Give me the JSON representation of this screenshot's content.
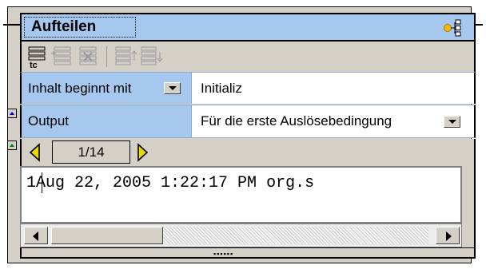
{
  "component": {
    "title": "Aufteilen",
    "title_icon": "connector-handle-icon"
  },
  "toolbar": {
    "buttons": [
      {
        "name": "insert-text-icon",
        "enabled": true
      },
      {
        "name": "insert-after-icon",
        "enabled": false
      },
      {
        "name": "delete-row-icon",
        "enabled": false
      },
      {
        "name": "move-up-icon",
        "enabled": false
      },
      {
        "name": "move-down-icon",
        "enabled": false
      }
    ]
  },
  "properties": [
    {
      "label": "Inhalt beginnt mit",
      "value": "Initializ",
      "has_dropdown": true,
      "dropdown_on": "label"
    },
    {
      "label": "Output",
      "value": "Für die erste Auslösebedingung",
      "has_dropdown": true,
      "dropdown_on": "value"
    }
  ],
  "pager": {
    "page_text": "1/14",
    "prev_icon": "chevron-left-icon",
    "next_icon": "chevron-right-icon"
  },
  "editor": {
    "line_number": "1",
    "line_text": "Aug 22, 2005 1:22:17 PM org.s"
  },
  "colors": {
    "header_bg": "#a6c8ef",
    "panel_bg": "#d4d0c8",
    "nav_arrow": "#e8d800"
  }
}
